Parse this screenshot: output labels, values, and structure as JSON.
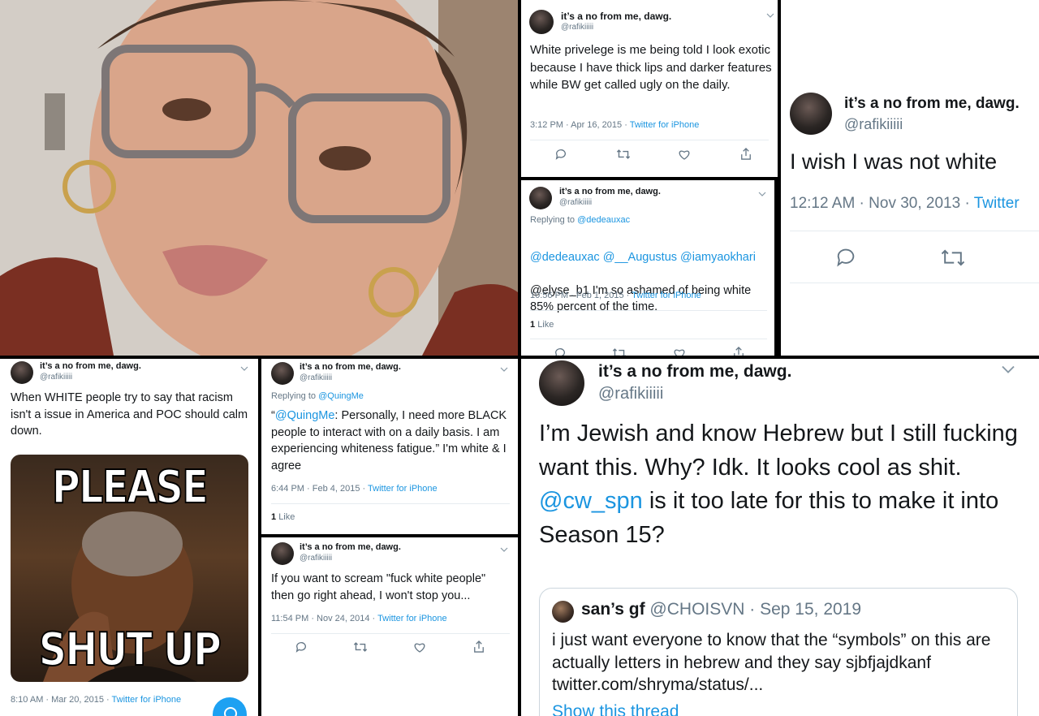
{
  "colors": {
    "accent": "#1b95e0",
    "text": "#14171a",
    "muted": "#657786"
  },
  "account": {
    "name": "it’s a no from me, dawg.",
    "handle": "@rafikiiiii"
  },
  "tweets": [
    {
      "id": "t1",
      "text": "White privelege is me being told I look exotic because I have thick lips and darker features while BW get called ugly on the daily.",
      "time": "3:12 PM · Apr 16, 2015",
      "source": "Twitter for iPhone"
    },
    {
      "id": "t2",
      "reply_label": "Replying to",
      "reply_to": "@dedeauxac",
      "mentions": "@dedeauxac @__Augustus @iamyaokhari",
      "text": "@elyse_b1 I'm so ashamed of being white 85% percent of the time.",
      "time": "10:56 PM · Feb 1, 2015",
      "source": "Twitter for iPhone",
      "likes_count": "1",
      "likes_label": "Like"
    },
    {
      "id": "t3",
      "text": "I wish I was not white",
      "time": "12:12 AM · Nov 30, 2013",
      "source": "Twitter"
    },
    {
      "id": "t4",
      "text": "When WHITE people try to say that racism isn't a issue in America and POC should calm down.",
      "meme_top": "PLEASE",
      "meme_bottom": "SHUT UP",
      "time": "8:10 AM · Mar 20, 2015",
      "source": "Twitter for iPhone"
    },
    {
      "id": "t5",
      "reply_label": "Replying to",
      "reply_to": "@QuingMe",
      "quote_open": "“",
      "mention": "@QuingMe",
      "text": ": Personally, I need more BLACK people to interact with on a daily basis. I am experiencing whiteness fatigue.” I'm white & I agree",
      "time": "6:44 PM · Feb 4, 2015",
      "source": "Twitter for iPhone",
      "likes_count": "1",
      "likes_label": "Like"
    },
    {
      "id": "t6",
      "text": "If you want to scream \"fuck white people\" then go right ahead, I won't stop you...",
      "time": "11:54 PM · Nov 24, 2014",
      "source": "Twitter for iPhone"
    },
    {
      "id": "t7",
      "text_a": "I’m Jewish and know Hebrew but I still fucking want this. Why? Idk. It looks cool as shit. ",
      "mention": "@cw_spn",
      "text_b": " is it too late for this to make it into Season 15?",
      "quoted": {
        "name": "san’s gf",
        "handle": "@CHOISVN",
        "date": "· Sep 15, 2019",
        "text": "i just want everyone to know that the “symbols” on this are actually letters in hebrew and they say sjbfjajdkanf twitter.com/shryma/status/...",
        "show_thread": "Show this thread"
      }
    }
  ],
  "icons": [
    "reply-icon",
    "retweet-icon",
    "like-icon",
    "share-icon",
    "chevron-down-icon",
    "compose-icon"
  ]
}
